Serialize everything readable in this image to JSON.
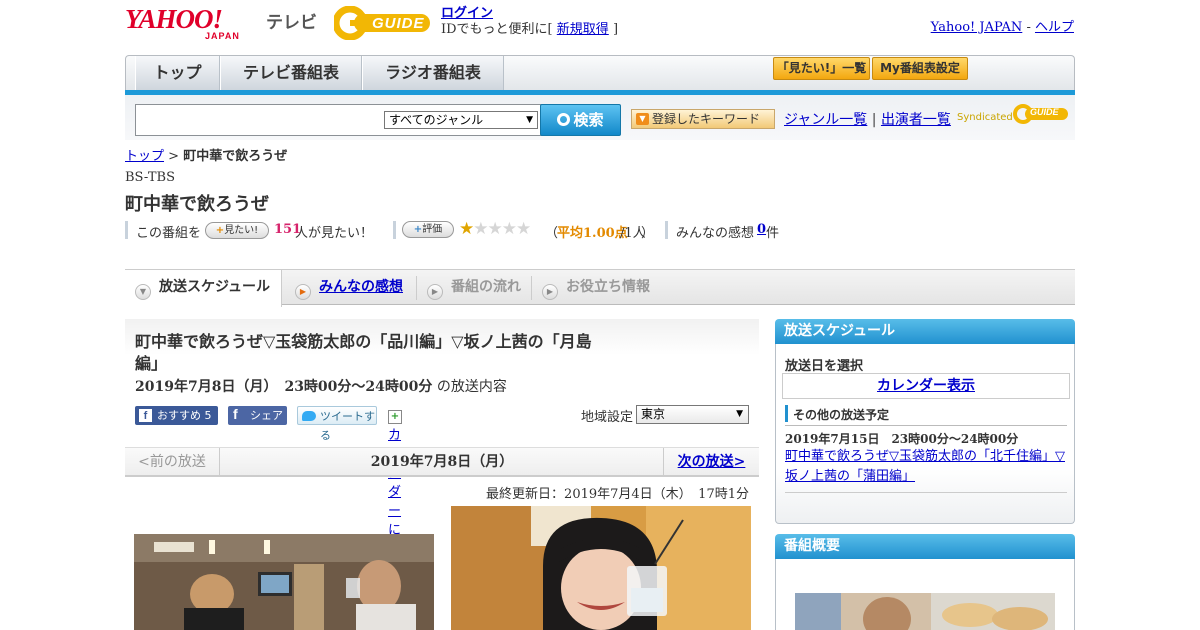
{
  "header": {
    "yahoo_logo": "YAHOO!",
    "yahoo_logo_sub": "JAPAN",
    "tv_label": "テレビ",
    "gguide_logo": "GUIDE",
    "login_link": "ログイン",
    "login_prompt": "IDでもっと便利に[",
    "signup_link": "新規取得",
    "login_prompt_end": "]",
    "yahoo_japan_link": "Yahoo! JAPAN",
    "separator": "-",
    "help_link": "ヘルプ"
  },
  "nav": {
    "tabs": [
      "トップ",
      "テレビ番組表",
      "ラジオ番組表"
    ],
    "mitai_list_button": "「見たい!」一覧",
    "my_schedule_button": "My番組表設定"
  },
  "search": {
    "input_value": "",
    "genre_selected": "すべてのジャンル",
    "search_button": "検索",
    "keyword_button": "登録したキーワード",
    "genre_list_link": "ジャンル一覧",
    "link_separator": "|",
    "performer_list_link": "出演者一覧",
    "syndicated_label": "Syndicated"
  },
  "breadcrumb": {
    "home": "トップ",
    "separator": ">",
    "current": "町中華で飲ろうぜ"
  },
  "program": {
    "channel": "BS-TBS",
    "title": "町中華で飲ろうぜ",
    "this_program_label": "この番組を",
    "mitai_pill": "見たい!",
    "mitai_count": "151",
    "mitai_suffix": "人が見たい！",
    "rating_pill": "評価",
    "rating_stars": 1,
    "rating_max": 5,
    "rating_open": "（",
    "rating_avg": "平均1.00点",
    "rating_people": "/1人",
    "rating_close": "）",
    "reviews_label": "みんなの感想",
    "reviews_count": "0",
    "reviews_unit": "件"
  },
  "tabs": [
    {
      "label": "放送スケジュール",
      "active": true
    },
    {
      "label": "みんなの感想",
      "link": true
    },
    {
      "label": "番組の流れ"
    },
    {
      "label": "お役立ち情報"
    }
  ],
  "episode": {
    "title": "町中華で飲ろうぜ▽玉袋筋太郎の「品川編」▽坂ノ上茜の「月島編」",
    "date_time": "2019年7月8日（月）　23時00分～24時00分",
    "date_time_suffix": "の放送内容",
    "recommend_button": "おすすめ",
    "recommend_count": "5",
    "share_button": "シェア",
    "tweet_button": "ツイートする",
    "calendar_link": "カレンダーに登録",
    "region_label": "地域設定",
    "region_selected": "東京"
  },
  "pager": {
    "prev": "<前の放送",
    "current": "2019年7月8日（月）",
    "next": "次の放送>"
  },
  "updated": "最終更新日：2019年7月4日（木）　17時1分",
  "sidebar": {
    "schedule_header": "放送スケジュール",
    "select_date_label": "放送日を選択",
    "calendar_link": "カレンダー表示",
    "other_schedule_label": "その他の放送予定",
    "other_items": [
      {
        "datetime": "2019年7月15日　23時00分～24時00分",
        "title": "町中華で飲ろうぜ▽玉袋筋太郎の「北千住編」▽坂ノ上茜の「蒲田編」"
      }
    ],
    "summary_header": "番組概要"
  }
}
